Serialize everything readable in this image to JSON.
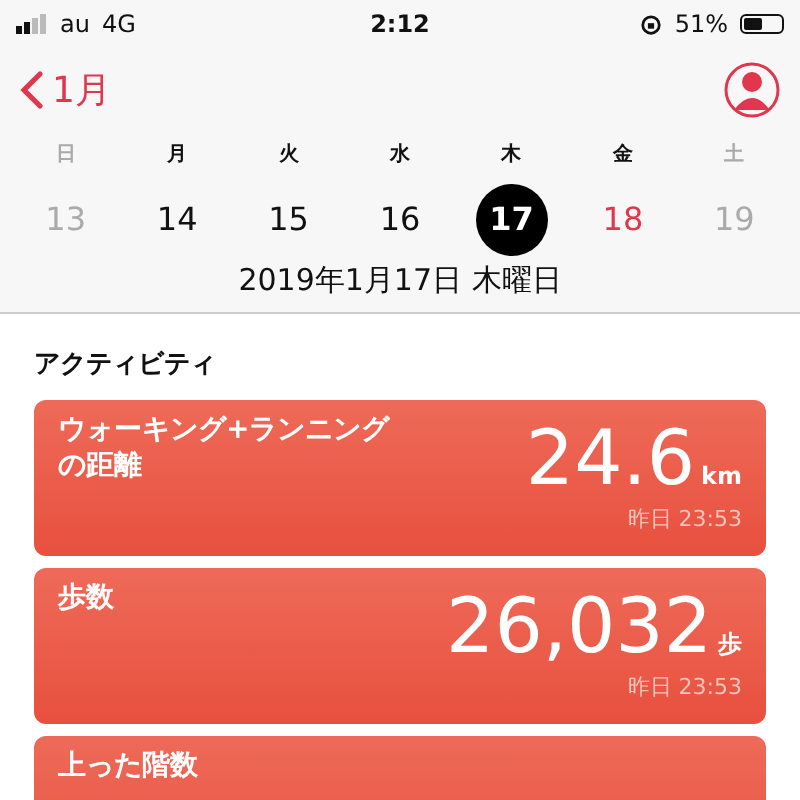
{
  "status_bar": {
    "carrier": "au",
    "network": "4G",
    "time": "2:12",
    "battery": "51%"
  },
  "nav": {
    "back": "1月"
  },
  "week": [
    {
      "weekday": "日",
      "day": "13",
      "weekend": true,
      "today": false,
      "selected": false
    },
    {
      "weekday": "月",
      "day": "14",
      "weekend": false,
      "today": false,
      "selected": false
    },
    {
      "weekday": "火",
      "day": "15",
      "weekend": false,
      "today": false,
      "selected": false
    },
    {
      "weekday": "水",
      "day": "16",
      "weekend": false,
      "today": false,
      "selected": false
    },
    {
      "weekday": "木",
      "day": "17",
      "weekend": false,
      "today": false,
      "selected": true
    },
    {
      "weekday": "金",
      "day": "18",
      "weekend": false,
      "today": true,
      "selected": false
    },
    {
      "weekday": "土",
      "day": "19",
      "weekend": true,
      "today": false,
      "selected": false
    }
  ],
  "date_title": "2019年1月17日 木曜日",
  "section": "アクティビティ",
  "cards": [
    {
      "label": "ウォーキング+ランニングの距離",
      "value": "24.6",
      "unit": "km",
      "time": "昨日 23:53"
    },
    {
      "label": "歩数",
      "value": "26,032",
      "unit": "歩",
      "time": "昨日 23:53"
    },
    {
      "label": "上った階数"
    }
  ]
}
